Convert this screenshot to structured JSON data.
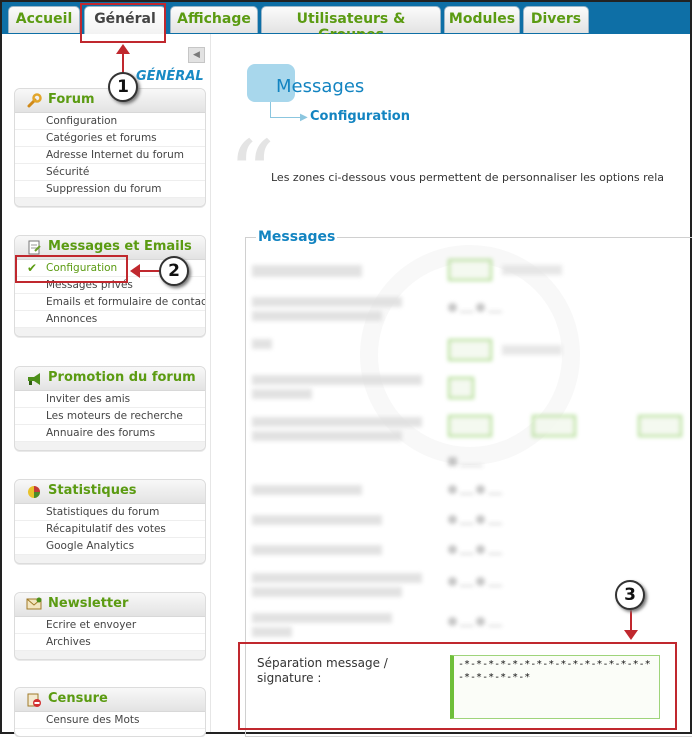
{
  "tabs": [
    {
      "label": "Accueil"
    },
    {
      "label": "Général"
    },
    {
      "label": "Affichage"
    },
    {
      "label": "Utilisateurs & Groupes"
    },
    {
      "label": "Modules"
    },
    {
      "label": "Divers"
    }
  ],
  "active_tab": "Général",
  "sidebar": {
    "collapse_glyph": "◀",
    "title": "GÉNÉRAL",
    "sections": [
      {
        "title": "Forum",
        "icon": "wrench-icon",
        "items": [
          {
            "label": "Configuration"
          },
          {
            "label": "Catégories et forums"
          },
          {
            "label": "Adresse Internet du forum"
          },
          {
            "label": "Sécurité"
          },
          {
            "label": "Suppression du forum"
          }
        ]
      },
      {
        "title": "Messages et Emails",
        "icon": "document-icon",
        "items": [
          {
            "label": "Configuration"
          },
          {
            "label": "Messages privés"
          },
          {
            "label": "Emails et formulaire de contact"
          },
          {
            "label": "Annonces"
          }
        ]
      },
      {
        "title": "Promotion du forum",
        "icon": "megaphone-icon",
        "items": [
          {
            "label": "Inviter des amis"
          },
          {
            "label": "Les moteurs de recherche"
          },
          {
            "label": "Annuaire des forums"
          }
        ]
      },
      {
        "title": "Statistiques",
        "icon": "pie-chart-icon",
        "items": [
          {
            "label": "Statistiques du forum"
          },
          {
            "label": "Récapitulatif des votes"
          },
          {
            "label": "Google Analytics"
          }
        ]
      },
      {
        "title": "Newsletter",
        "icon": "envelope-icon",
        "items": [
          {
            "label": "Ecrire et envoyer"
          },
          {
            "label": "Archives"
          }
        ]
      },
      {
        "title": "Censure",
        "icon": "no-entry-icon",
        "items": [
          {
            "label": "Censure des Mots"
          }
        ]
      }
    ],
    "selected_item": "Messages et Emails / Configuration"
  },
  "main": {
    "title": "Messages",
    "subtitle": "Configuration",
    "intro": "Les zones ci-dessous vous permettent de personnaliser les options rela",
    "fieldset_legend": "Messages",
    "separator_label": "Séparation message / signature :",
    "separator_value": "-*-*-*-*-*-*-*-*-*-*-*-*-*-*-*-*-*-*-*-*-*-*"
  },
  "annotations": [
    "1",
    "2",
    "3"
  ],
  "colors": {
    "accent_green": "#5b9b12",
    "accent_blue": "#1384c1",
    "annotation_red": "#c0282e",
    "tabbar_blue": "#0e6fa6"
  }
}
